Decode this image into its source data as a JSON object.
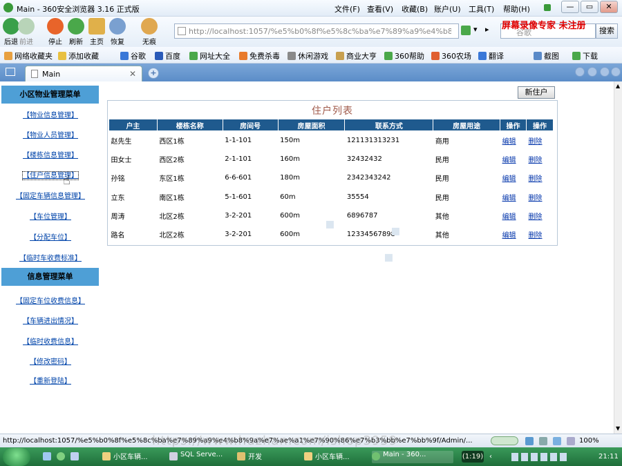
{
  "browser": {
    "title": "Main - 360安全浏览器 3.16 正式版",
    "menu": [
      "文件(F)",
      "查看(V)",
      "收藏(B)",
      "账户(U)",
      "工具(T)",
      "帮助(H)"
    ],
    "nav_buttons": [
      "后退",
      "前进",
      "停止",
      "刷新",
      "主页",
      "恢复",
      "无痕"
    ],
    "address": "http://localhost:1057/%e5%b0%8f%e5%8c%ba%e7%89%a9%e4%b8%9a%e7%ae%a1%e7%90%86",
    "search_placeholder": "谷歌",
    "search_button": "搜索",
    "recorder_watermark": "屏幕录像专家  未注册",
    "favorites": [
      "网络收藏夹",
      "添加收藏",
      "谷歌",
      "百度",
      "网址大全",
      "免费杀毒",
      "休闲游戏",
      "商业大亨",
      "360帮助",
      "360农场",
      "翻译",
      "截图",
      "下载"
    ],
    "tab_label": "Main",
    "status_url": "http://localhost:1057/%e5%b0%8f%e5%8c%ba%e7%89%a9%e4%b8%9a%e7%ae%a1%e7%90%86%e7%b3%bb%e7%bb%9f/Admin/...",
    "zoom": "100%",
    "overlay_watermark": "https://www.huzhan.com/ishop3959"
  },
  "sidebar": {
    "group1_title": "小区物业管理菜单",
    "group1_items": [
      "【物业信息管理】",
      "【物业人员管理】",
      "【楼栋信息管理】",
      "【住户信息管理】",
      "【固定车辆信息管理】",
      "【车位管理】",
      "【分配车位】",
      "【临时车收费标准】"
    ],
    "group2_title": "信息管理菜单",
    "group2_items": [
      "【固定车位收费信息】",
      "【车辆进出情况】",
      "【临时收费信息】",
      "【修改密码】",
      "【重新登陆】"
    ]
  },
  "main": {
    "new_button": "新住户",
    "table_title": "住户列表",
    "columns": [
      "户主",
      "楼栋名称",
      "房间号",
      "房屋面积",
      "联系方式",
      "房屋用途",
      "操作",
      "操作"
    ],
    "rows": [
      [
        "赵先生",
        "西区1栋",
        "1-1-101",
        "150m",
        "121131313231",
        "商用",
        "编辑",
        "删除"
      ],
      [
        "田女士",
        "西区2栋",
        "2-1-101",
        "160m",
        "32432432",
        "民用",
        "编辑",
        "删除"
      ],
      [
        "孙铭",
        "东区1栋",
        "6-6-601",
        "180m",
        "2342343242",
        "民用",
        "编辑",
        "删除"
      ],
      [
        "立东",
        "南区1栋",
        "5-1-601",
        "60m",
        "35554",
        "民用",
        "编辑",
        "删除"
      ],
      [
        "周涛",
        "北区2栋",
        "3-2-201",
        "600m",
        "6896787",
        "其他",
        "编辑",
        "删除"
      ],
      [
        "路名",
        "北区2栋",
        "3-2-201",
        "600m",
        "12334567898",
        "其他",
        "编辑",
        "删除"
      ]
    ]
  },
  "taskbar": {
    "items": [
      "小区车辆...",
      "SQL Serve...",
      "开发",
      "小区车辆...",
      "Main - 360..."
    ],
    "counter": "(1:19)",
    "time": "21:11"
  }
}
